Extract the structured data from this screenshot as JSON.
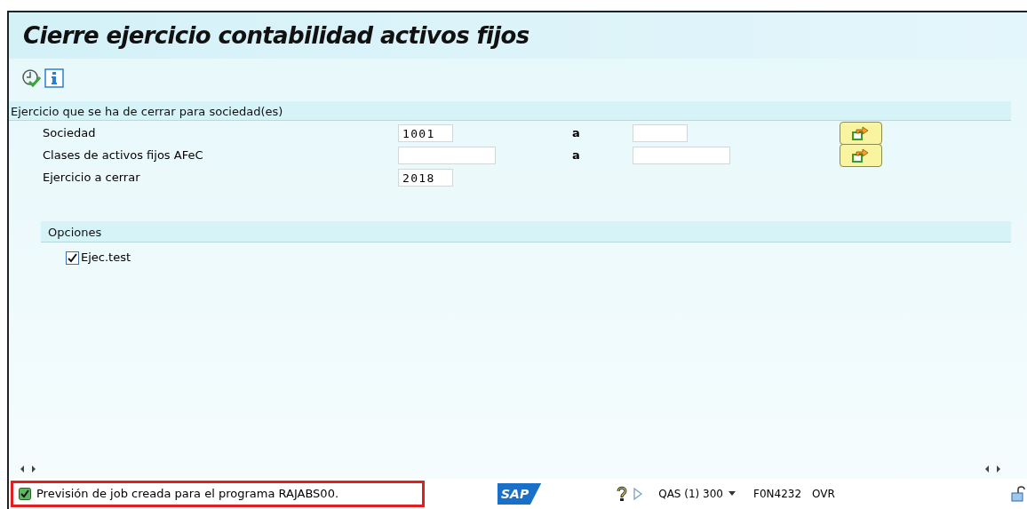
{
  "title": "Cierre ejercicio contabilidad activos fijos",
  "section": {
    "title": "Ejercicio que se ha de cerrar para sociedad(es)",
    "rows": [
      {
        "kind": "range",
        "label": "Sociedad",
        "from": "1001",
        "to_label": "a"
      },
      {
        "kind": "range",
        "label": "Clases de activos fijos AFeC",
        "from": "",
        "to_label": "a"
      },
      {
        "kind": "single",
        "label": "Ejercicio a cerrar",
        "from": "2018"
      }
    ]
  },
  "options": {
    "title": "Opciones",
    "items": [
      {
        "label": "Ejec.test",
        "checked": true
      }
    ]
  },
  "status": {
    "message": "Previsión de job creada para el programa RAJABS00.",
    "logo": "SAP",
    "system": "QAS (1) 300",
    "server": "F0N4232",
    "mode": "OVR"
  }
}
